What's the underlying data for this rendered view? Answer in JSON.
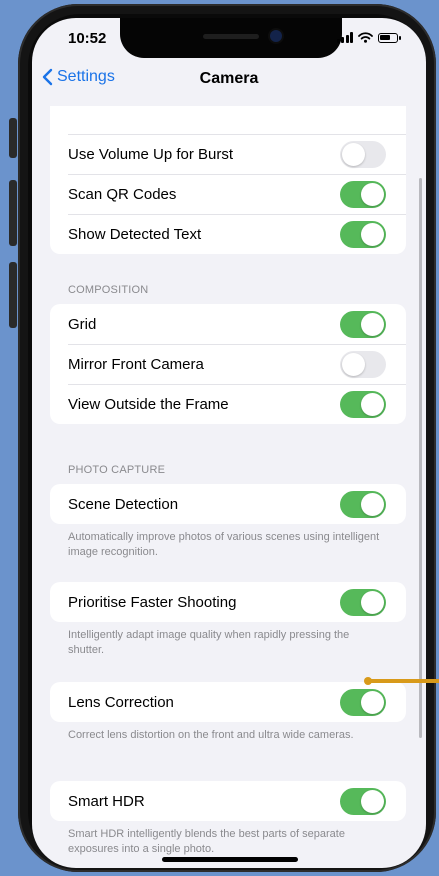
{
  "status": {
    "time": "10:52"
  },
  "nav": {
    "back_label": "Settings",
    "title": "Camera"
  },
  "groups": [
    {
      "rows": [
        {
          "label": "Use Volume Up for Burst",
          "on": false
        },
        {
          "label": "Scan QR Codes",
          "on": true
        },
        {
          "label": "Show Detected Text",
          "on": true
        }
      ]
    },
    {
      "header": "COMPOSITION",
      "rows": [
        {
          "label": "Grid",
          "on": true
        },
        {
          "label": "Mirror Front Camera",
          "on": false
        },
        {
          "label": "View Outside the Frame",
          "on": true
        }
      ]
    },
    {
      "header": "PHOTO CAPTURE",
      "rows": [
        {
          "label": "Scene Detection",
          "on": true
        }
      ],
      "footer": "Automatically improve photos of various scenes using intelligent image recognition."
    },
    {
      "rows": [
        {
          "label": "Prioritise Faster Shooting",
          "on": true
        }
      ],
      "footer": "Intelligently adapt image quality when rapidly pressing the shutter."
    },
    {
      "rows": [
        {
          "label": "Lens Correction",
          "on": true
        }
      ],
      "footer": "Correct lens distortion on the front and ultra wide cameras."
    },
    {
      "rows": [
        {
          "label": "Smart HDR",
          "on": true
        }
      ],
      "footer": "Smart HDR intelligently blends the best parts of separate exposures into a single photo."
    }
  ],
  "colors": {
    "accent_blue": "#1a73e8",
    "toggle_on": "#56b95a",
    "toggle_off": "#e8e8ec",
    "annotation": "#d89a1a",
    "background": "#6b93cc"
  },
  "icons": {
    "back": "chevron-left-icon",
    "wifi": "wifi-icon",
    "signal": "cellular-signal-icon",
    "battery": "battery-icon"
  }
}
